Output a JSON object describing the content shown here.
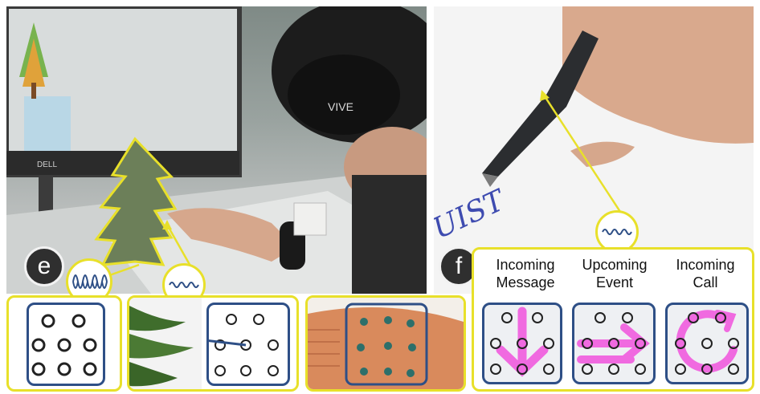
{
  "panel_e": {
    "label": "e"
  },
  "panel_f": {
    "label": "f",
    "handwriting": "UIST",
    "patterns": [
      {
        "line1": "Incoming",
        "line2": "Message"
      },
      {
        "line1": "Upcoming",
        "line2": "Event"
      },
      {
        "line1": "Incoming",
        "line2": "Call"
      }
    ]
  },
  "headset": {
    "brand": "VIVE"
  },
  "monitor": {
    "brand": "DELL"
  },
  "colors": {
    "highlight_yellow": "#e8e02a",
    "pattern_blue": "#2e4f86",
    "motion_magenta": "#f06ae0",
    "label_dark": "#2f2f2f"
  }
}
